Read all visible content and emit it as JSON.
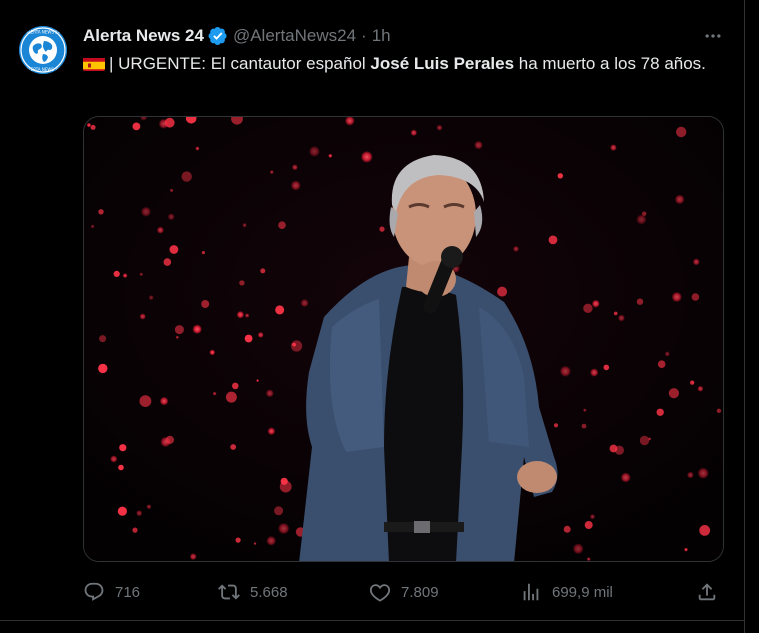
{
  "tweet": {
    "display_name": "Alerta News 24",
    "handle": "@AlertaNews24",
    "separator": "·",
    "time": "1h",
    "text_prefix": "| URGENTE: El cantautor español ",
    "text_bold": "José Luis Perales",
    "text_suffix": " ha muerto a los 78 años."
  },
  "avatar": {
    "ring_text_top": "ALERTA NEWS 24",
    "ring_text_bottom": "ALERTA NEWS 24"
  },
  "media": {
    "background_color": "#050204",
    "light_color": "#ff3448"
  },
  "actions": {
    "replies": "716",
    "reposts": "5.668",
    "likes": "7.809",
    "views": "699,9 mil"
  },
  "icons": {
    "verified": "verified-badge-icon",
    "more": "more-dots-icon",
    "reply": "reply-icon",
    "repost": "repost-icon",
    "like": "heart-icon",
    "views": "views-icon",
    "share": "share-icon",
    "flag": "spain-flag-icon"
  },
  "colors": {
    "background": "#000000",
    "text": "#e7e9ea",
    "muted": "#71767b",
    "verified_blue": "#1d9bf0",
    "border": "#2f3336"
  }
}
